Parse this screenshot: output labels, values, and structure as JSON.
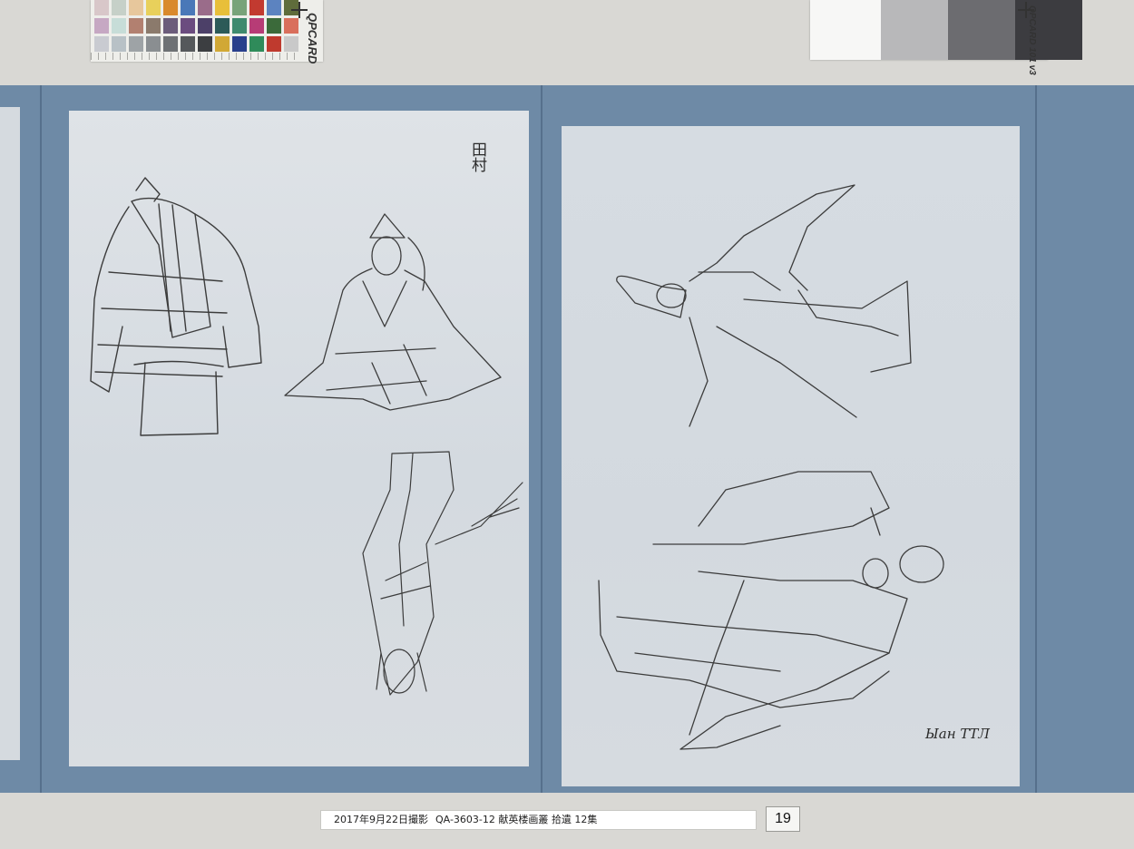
{
  "calibration_cards": {
    "color_card_brand": "QPCARD",
    "gray_card_brand": "QPCARD 101 v3",
    "swatches": [
      "#d8c7c9",
      "#c6d0c8",
      "#e7c79c",
      "#e8d05b",
      "#d98a2d",
      "#4a78b8",
      "#9a6c8a",
      "#e8bf3a",
      "#78a37a",
      "#c23a30",
      "#5c83c0",
      "#5f6c3b",
      "#c6a8c3",
      "#c7ddd8",
      "#b28070",
      "#8b7a6c",
      "#6b5c7a",
      "#6b4c7f",
      "#4c4068",
      "#2c5a58",
      "#3f8a6e",
      "#b73c76",
      "#3b6a3a",
      "#d96f5c",
      "#c9cbd1",
      "#b8c1c6",
      "#9ea3a6",
      "#8a8e91",
      "#6e7174",
      "#55585b",
      "#3c3e41",
      "#d1a835",
      "#293f8c",
      "#2f8b5a",
      "#bf3a2e",
      "#c9c9c9"
    ],
    "gray_patches": [
      "#f7f7f6",
      "#b8b8ba",
      "#6c6c70",
      "#3c3c40"
    ]
  },
  "artwork": {
    "left_sheet_seal": "田村",
    "right_sheet_signature": "Ыан ТТЛ"
  },
  "caption": {
    "date": "2017年9月22日撮影",
    "catalog": "QA-3603-12  献英楼画叢  拾遺  12集"
  },
  "page_number": "19",
  "colors": {
    "board": "#6e8aa6",
    "paper": "#d8dde2",
    "background": "#d9d8d4"
  }
}
